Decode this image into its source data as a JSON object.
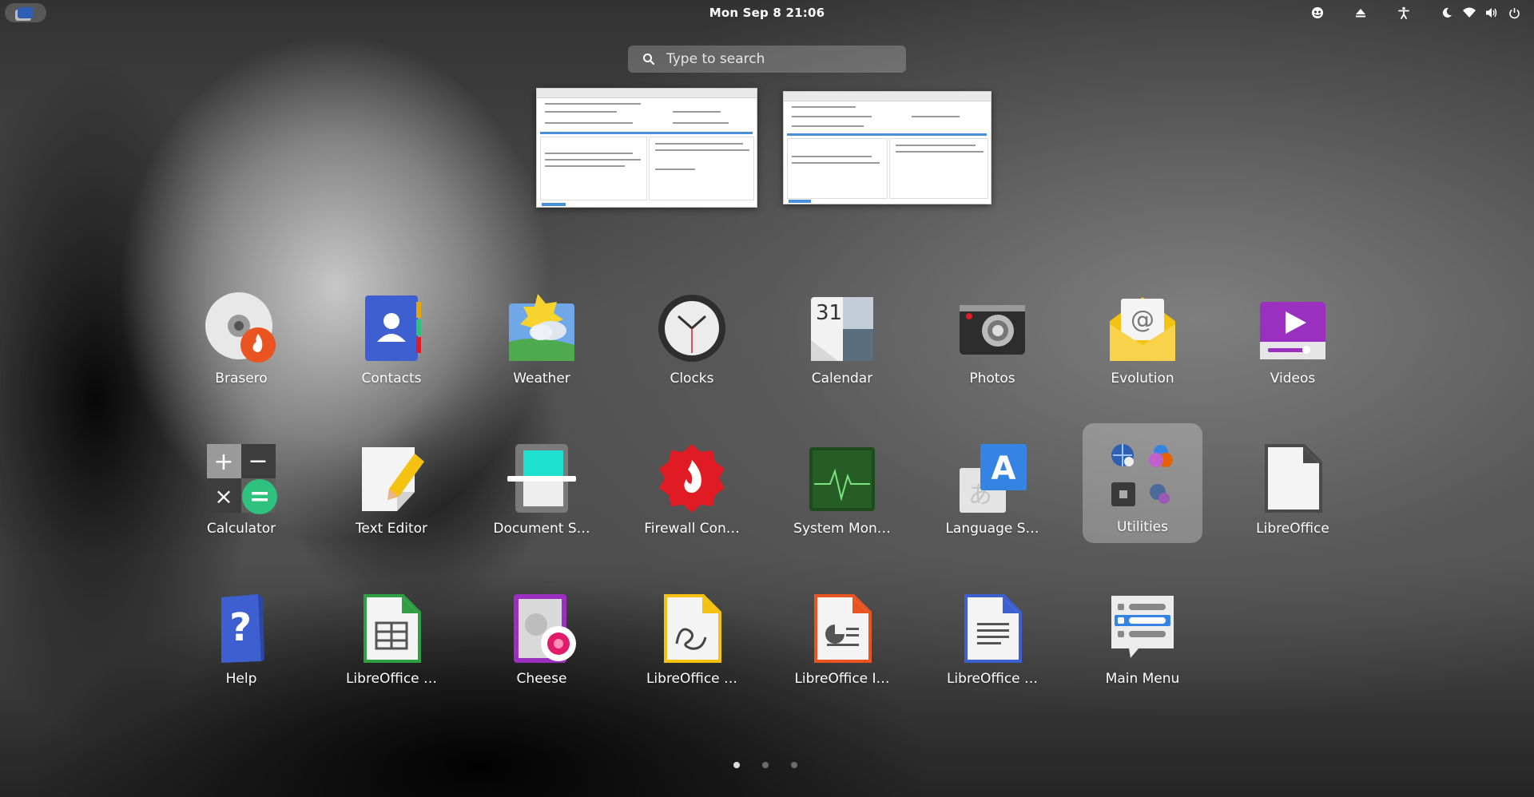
{
  "topbar": {
    "clock": "Mon Sep 8  21:06",
    "tray_icons": [
      "screen-share-icon",
      "eject-icon",
      "accessibility-icon",
      "night-light-icon",
      "wifi-icon",
      "volume-icon",
      "power-icon"
    ]
  },
  "search": {
    "placeholder": "Type to search"
  },
  "apps": [
    {
      "label": "Brasero",
      "icon": "brasero-icon"
    },
    {
      "label": "Contacts",
      "icon": "contacts-icon"
    },
    {
      "label": "Weather",
      "icon": "weather-icon"
    },
    {
      "label": "Clocks",
      "icon": "clocks-icon"
    },
    {
      "label": "Calendar",
      "icon": "calendar-icon",
      "day": "31"
    },
    {
      "label": "Photos",
      "icon": "photos-icon"
    },
    {
      "label": "Evolution",
      "icon": "evolution-icon"
    },
    {
      "label": "Videos",
      "icon": "videos-icon"
    },
    {
      "label": "Calculator",
      "icon": "calculator-icon"
    },
    {
      "label": "Text Editor",
      "icon": "text-editor-icon"
    },
    {
      "label": "Document S…",
      "icon": "document-scanner-icon"
    },
    {
      "label": "Firewall Con…",
      "icon": "firewall-icon"
    },
    {
      "label": "System Mon…",
      "icon": "system-monitor-icon"
    },
    {
      "label": "Language S…",
      "icon": "language-support-icon",
      "glyph": "A"
    },
    {
      "label": "Utilities",
      "icon": "utilities-folder-icon",
      "selected": true
    },
    {
      "label": "LibreOffice",
      "icon": "libreoffice-icon"
    },
    {
      "label": "Help",
      "icon": "help-icon",
      "glyph": "?"
    },
    {
      "label": "LibreOffice …",
      "icon": "libreoffice-calc-icon"
    },
    {
      "label": "Cheese",
      "icon": "cheese-icon"
    },
    {
      "label": "LibreOffice …",
      "icon": "libreoffice-draw-icon"
    },
    {
      "label": "LibreOffice I…",
      "icon": "libreoffice-impress-icon"
    },
    {
      "label": "LibreOffice …",
      "icon": "libreoffice-writer-icon"
    },
    {
      "label": "Main Menu",
      "icon": "main-menu-icon"
    }
  ],
  "pages": {
    "count": 3,
    "current": 1
  }
}
